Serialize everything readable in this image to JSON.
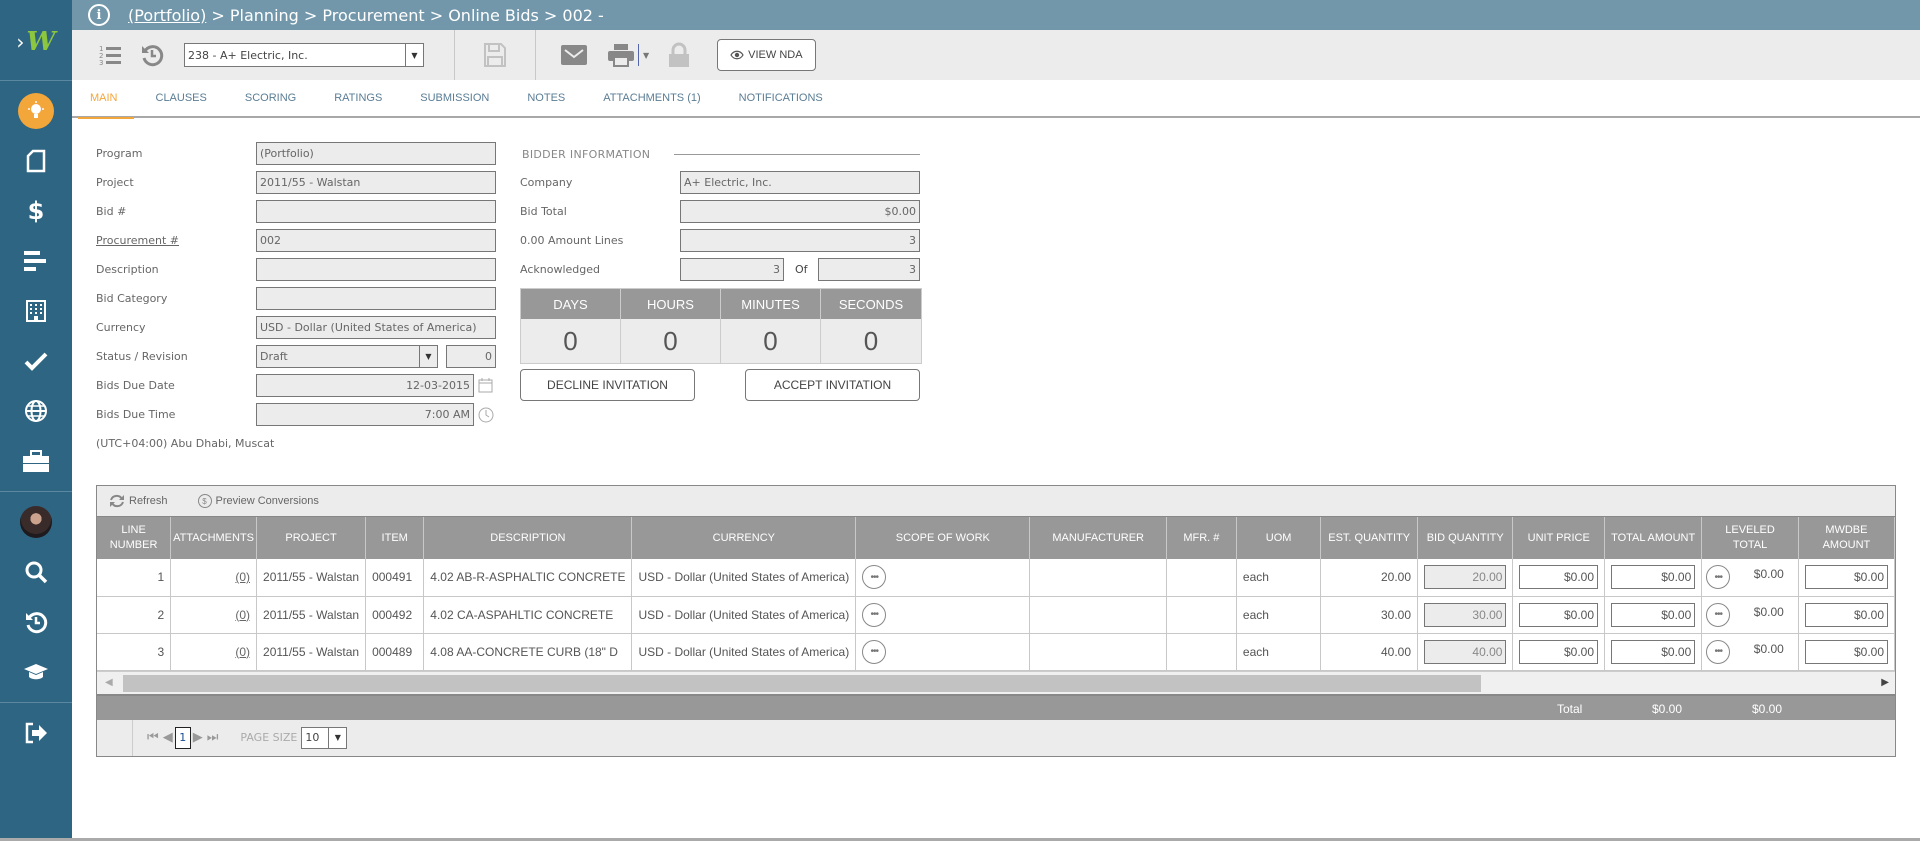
{
  "breadcrumb": {
    "root_link": "(Portfolio)",
    "path": " > Planning > Procurement > Online Bids > 002 -"
  },
  "toolbar": {
    "record_select": "238 - A+ Electric, Inc.",
    "view_nda_label": "VIEW NDA"
  },
  "tabs": [
    {
      "label": "MAIN",
      "active": true
    },
    {
      "label": "CLAUSES"
    },
    {
      "label": "SCORING"
    },
    {
      "label": "RATINGS"
    },
    {
      "label": "SUBMISSION"
    },
    {
      "label": "NOTES"
    },
    {
      "label": "ATTACHMENTS (1)"
    },
    {
      "label": "NOTIFICATIONS"
    }
  ],
  "form": {
    "program": {
      "label": "Program",
      "value": "(Portfolio)"
    },
    "project": {
      "label": "Project",
      "value": "2011/55 - Walstan"
    },
    "bid_no": {
      "label": "Bid #",
      "value": ""
    },
    "procurement_no": {
      "label": "Procurement #",
      "value": "002"
    },
    "description": {
      "label": "Description",
      "value": ""
    },
    "bid_category": {
      "label": "Bid Category",
      "value": ""
    },
    "currency": {
      "label": "Currency",
      "value": "USD - Dollar (United States of America)"
    },
    "status_revision": {
      "label": "Status / Revision",
      "status": "Draft",
      "revision": "0"
    },
    "bids_due_date": {
      "label": "Bids Due Date",
      "value": "12-03-2015"
    },
    "bids_due_time": {
      "label": "Bids Due Time",
      "value": "7:00 AM"
    },
    "timezone": "(UTC+04:00) Abu Dhabi, Muscat"
  },
  "bidder": {
    "section_title": "BIDDER INFORMATION",
    "company": {
      "label": "Company",
      "value": "A+ Electric, Inc."
    },
    "bid_total": {
      "label": "Bid Total",
      "value": "$0.00"
    },
    "zero_amount_lines": {
      "label": "0.00 Amount Lines",
      "value": "3"
    },
    "acknowledged": {
      "label": "Acknowledged",
      "value": "3",
      "of_label": "Of",
      "of_value": "3"
    }
  },
  "countdown": {
    "days": {
      "label": "DAYS",
      "value": "0"
    },
    "hours": {
      "label": "HOURS",
      "value": "0"
    },
    "minutes": {
      "label": "MINUTES",
      "value": "0"
    },
    "seconds": {
      "label": "SECONDS",
      "value": "0"
    }
  },
  "actions": {
    "decline": "DECLINE INVITATION",
    "accept": "ACCEPT INVITATION"
  },
  "grid": {
    "refresh_label": "Refresh",
    "preview_label": "Preview Conversions",
    "columns": [
      "LINE NUMBER",
      "ATTACHMENTS",
      "PROJECT",
      "ITEM",
      "DESCRIPTION",
      "CURRENCY",
      "SCOPE OF WORK",
      "MANUFACTURER",
      "MFR. #",
      "UOM",
      "EST. QUANTITY",
      "BID QUANTITY",
      "UNIT PRICE",
      "TOTAL AMOUNT",
      "LEVELED TOTAL",
      "MWDBE AMOUNT"
    ],
    "rows": [
      {
        "line": "1",
        "attachments": "(0)",
        "project": "2011/55 - Walstan",
        "item": "000491",
        "description": "4.02 AB-R-ASPHALTIC CONCRETE",
        "currency": "USD - Dollar (United States of America)",
        "manufacturer": "",
        "mfr_no": "",
        "uom": "each",
        "est_qty": "20.00",
        "bid_qty": "20.00",
        "unit_price": "$0.00",
        "total_amount": "$0.00",
        "leveled_total": "$0.00",
        "mwdbe_amount": "$0.00"
      },
      {
        "line": "2",
        "attachments": "(0)",
        "project": "2011/55 - Walstan",
        "item": "000492",
        "description": "4.02 CA-ASPAHLTIC CONCRETE",
        "currency": "USD - Dollar (United States of America)",
        "manufacturer": "",
        "mfr_no": "",
        "uom": "each",
        "est_qty": "30.00",
        "bid_qty": "30.00",
        "unit_price": "$0.00",
        "total_amount": "$0.00",
        "leveled_total": "$0.00",
        "mwdbe_amount": "$0.00"
      },
      {
        "line": "3",
        "attachments": "(0)",
        "project": "2011/55 - Walstan",
        "item": "000489",
        "description": "4.08 AA-CONCRETE CURB (18\" D",
        "currency": "USD - Dollar (United States of America)",
        "manufacturer": "",
        "mfr_no": "",
        "uom": "each",
        "est_qty": "40.00",
        "bid_qty": "40.00",
        "unit_price": "$0.00",
        "total_amount": "$0.00",
        "leveled_total": "$0.00",
        "mwdbe_amount": "$0.00"
      }
    ],
    "footer": {
      "total_label": "Total",
      "total_amount": "$0.00",
      "leveled_total": "$0.00"
    },
    "pager": {
      "current_page": "1",
      "page_size_label": "PAGE SIZE",
      "page_size": "10"
    }
  },
  "colors": {
    "sidebar": "#2e6583",
    "topbar": "#7297ab",
    "accent": "#f3a63a",
    "grid_header": "#989898"
  }
}
